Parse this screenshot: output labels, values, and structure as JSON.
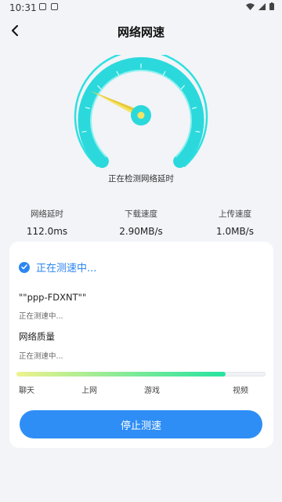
{
  "status_bar": {
    "time": "10:31"
  },
  "header": {
    "title": "网络网速"
  },
  "gauge": {
    "caption": "正在检测网络延时"
  },
  "stats": [
    {
      "label": "网络延时",
      "value": "112.0ms"
    },
    {
      "label": "下载速度",
      "value": "2.90MB/s"
    },
    {
      "label": "上传速度",
      "value": "1.0MB/s"
    }
  ],
  "card": {
    "status_label": "正在测速中...",
    "network_name": "\"\"ppp-FDXNT\"\"",
    "network_sub": "正在测速中...",
    "quality_title": "网络质量",
    "quality_sub": "正在测速中...",
    "quality_progress": 0.84,
    "usage_labels": [
      "聊天",
      "上网",
      "游戏",
      "视频"
    ],
    "stop_button": "停止测速"
  },
  "colors": {
    "accent": "#2e8ef5",
    "gauge": "#2ee0e0"
  }
}
